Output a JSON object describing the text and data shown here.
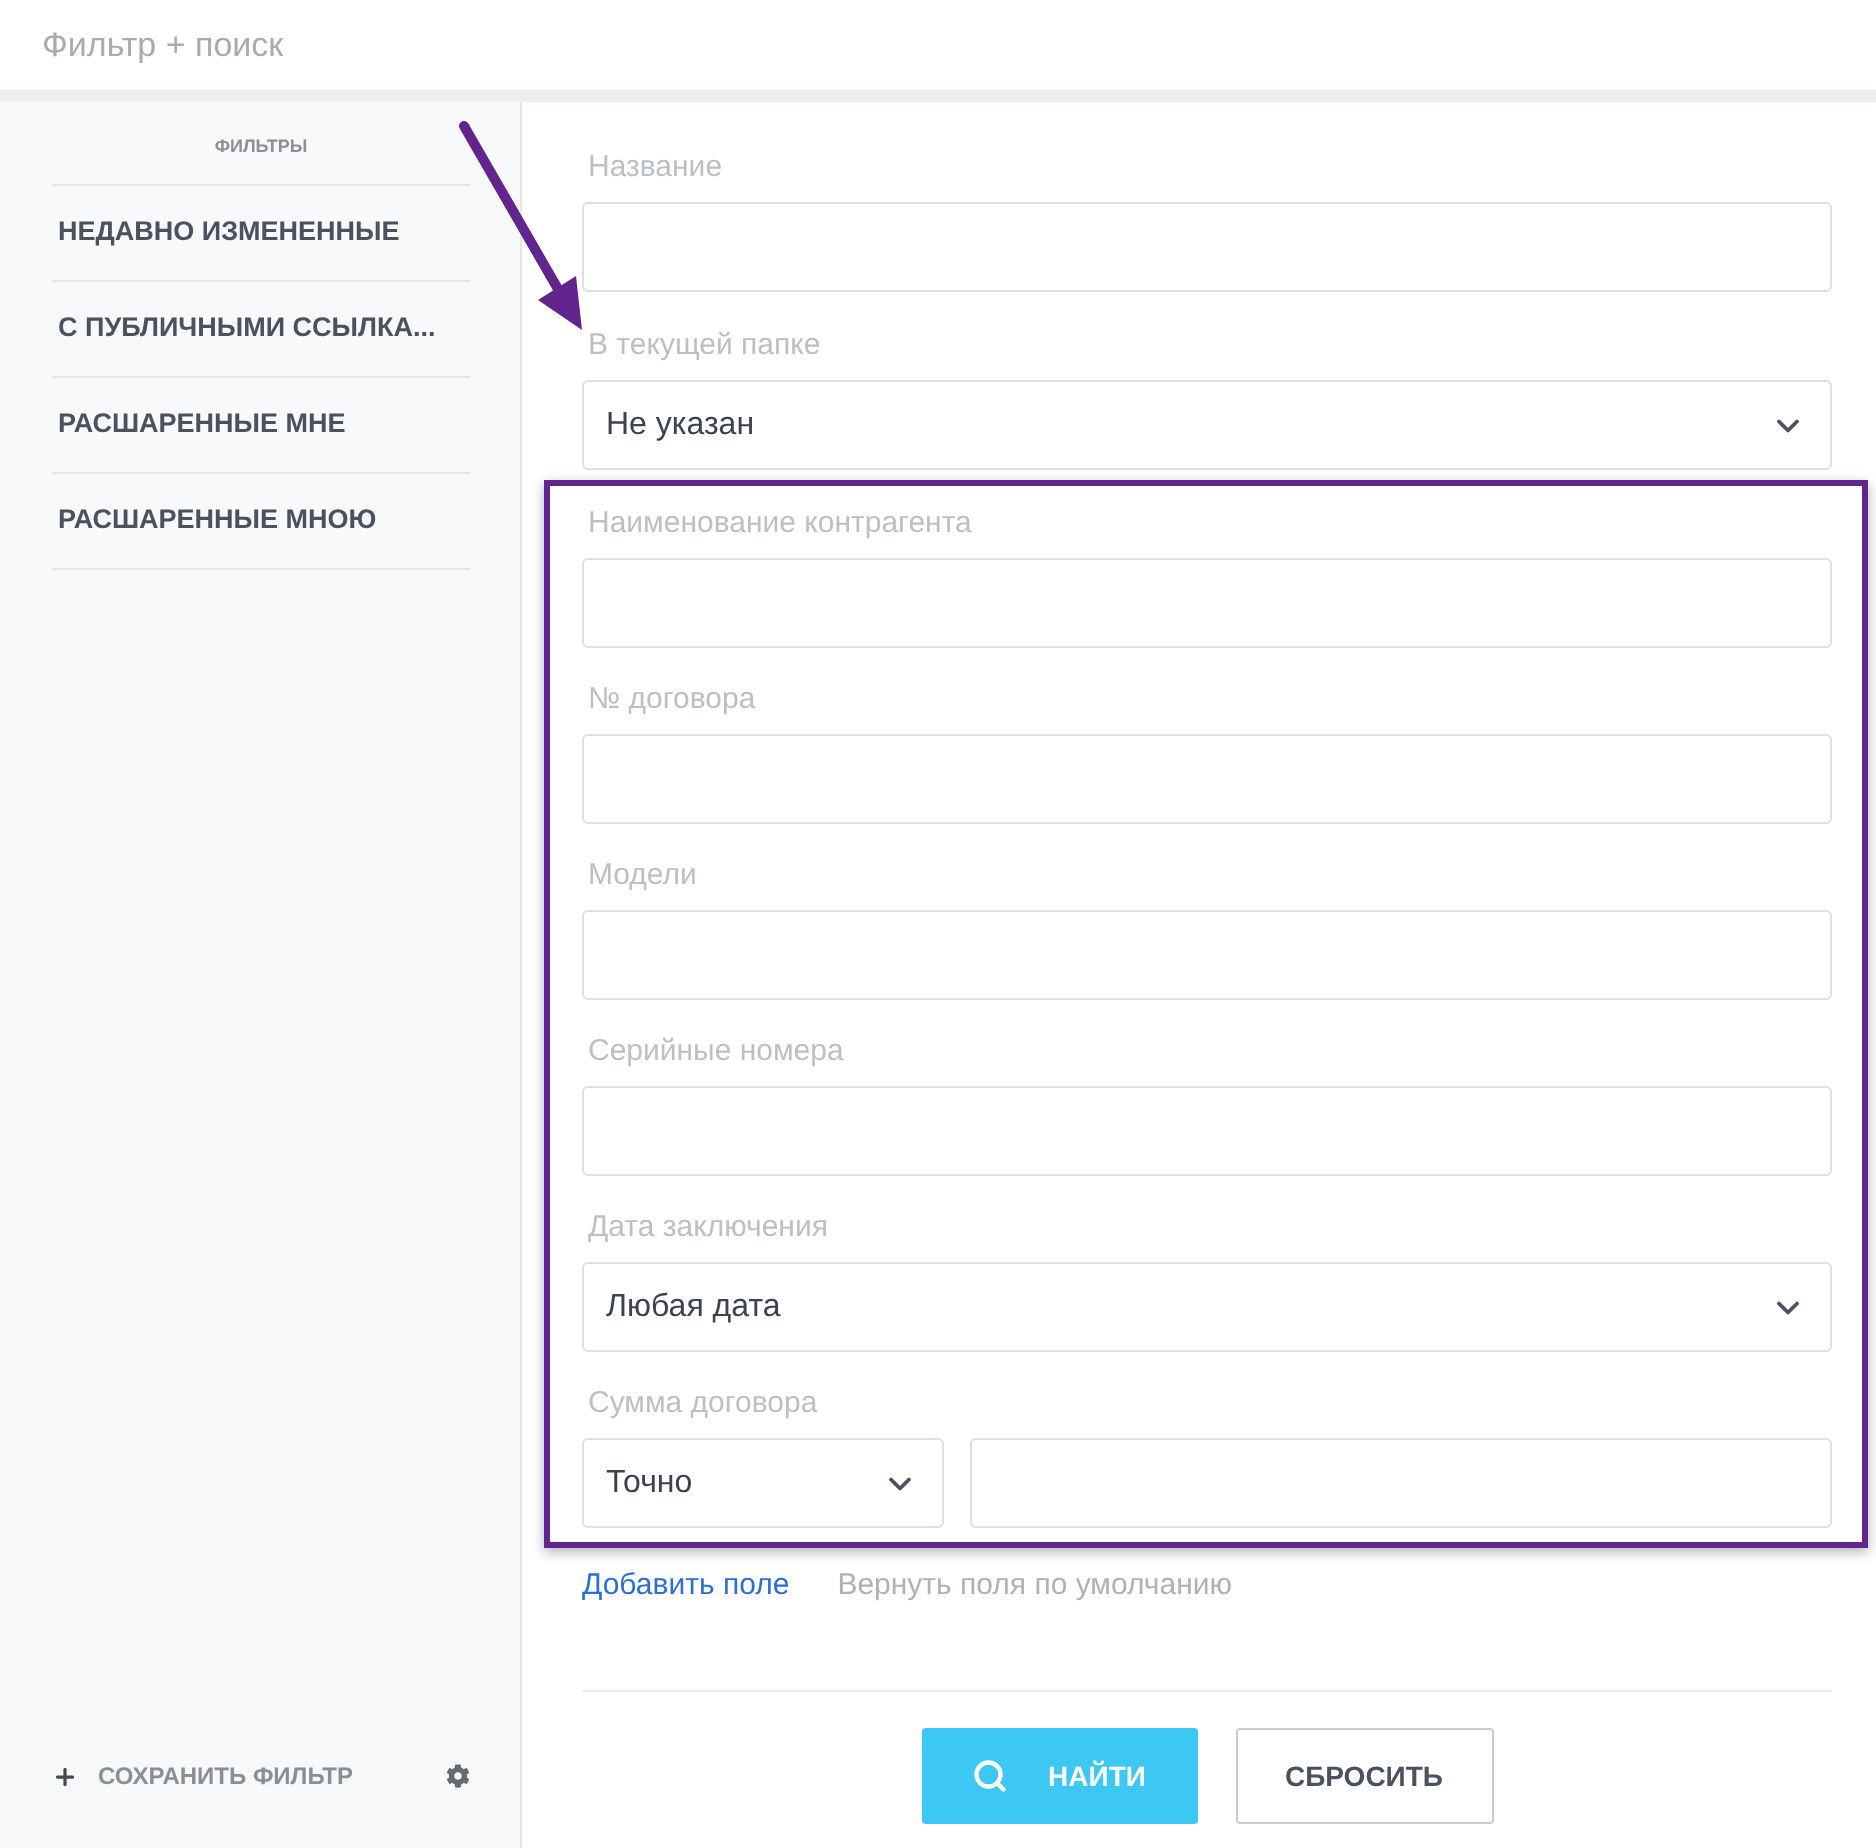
{
  "header": {
    "title": "Фильтр + поиск"
  },
  "sidebar": {
    "heading": "ФИЛЬТРЫ",
    "items": [
      {
        "label": "НЕДАВНО ИЗМЕНЕННЫЕ",
        "selected": false
      },
      {
        "label": "С ПУБЛИЧНЫМИ ССЫЛКА...",
        "selected": false
      },
      {
        "label": "РАСШАРЕННЫЕ МНЕ",
        "selected": false
      },
      {
        "label": "РАСШАРЕННЫЕ МНОЮ",
        "selected": false
      }
    ],
    "save_filter": "СОХРАНИТЬ ФИЛЬТР"
  },
  "form": {
    "fields": [
      {
        "kind": "text",
        "label": "Название"
      },
      {
        "kind": "select",
        "label": "В текущей папке",
        "value": "Не указан"
      }
    ],
    "highlighted_fields": [
      {
        "kind": "text",
        "label": "Наименование контрагента"
      },
      {
        "kind": "text",
        "label": "№ договора"
      },
      {
        "kind": "text",
        "label": "Модели"
      },
      {
        "kind": "text",
        "label": "Серийные номера"
      },
      {
        "kind": "select",
        "label": "Дата заключения",
        "value": "Любая дата"
      },
      {
        "kind": "range",
        "label": "Сумма договора",
        "value": "Точно"
      }
    ],
    "links": [
      {
        "kind": "action",
        "label": "Добавить поле"
      },
      {
        "kind": "muted",
        "label": "Вернуть поля по умолчанию"
      }
    ],
    "buttons": [
      {
        "kind": "primary",
        "label": "НАЙТИ"
      },
      {
        "kind": "secondary",
        "label": "СБРОСИТЬ"
      }
    ]
  }
}
